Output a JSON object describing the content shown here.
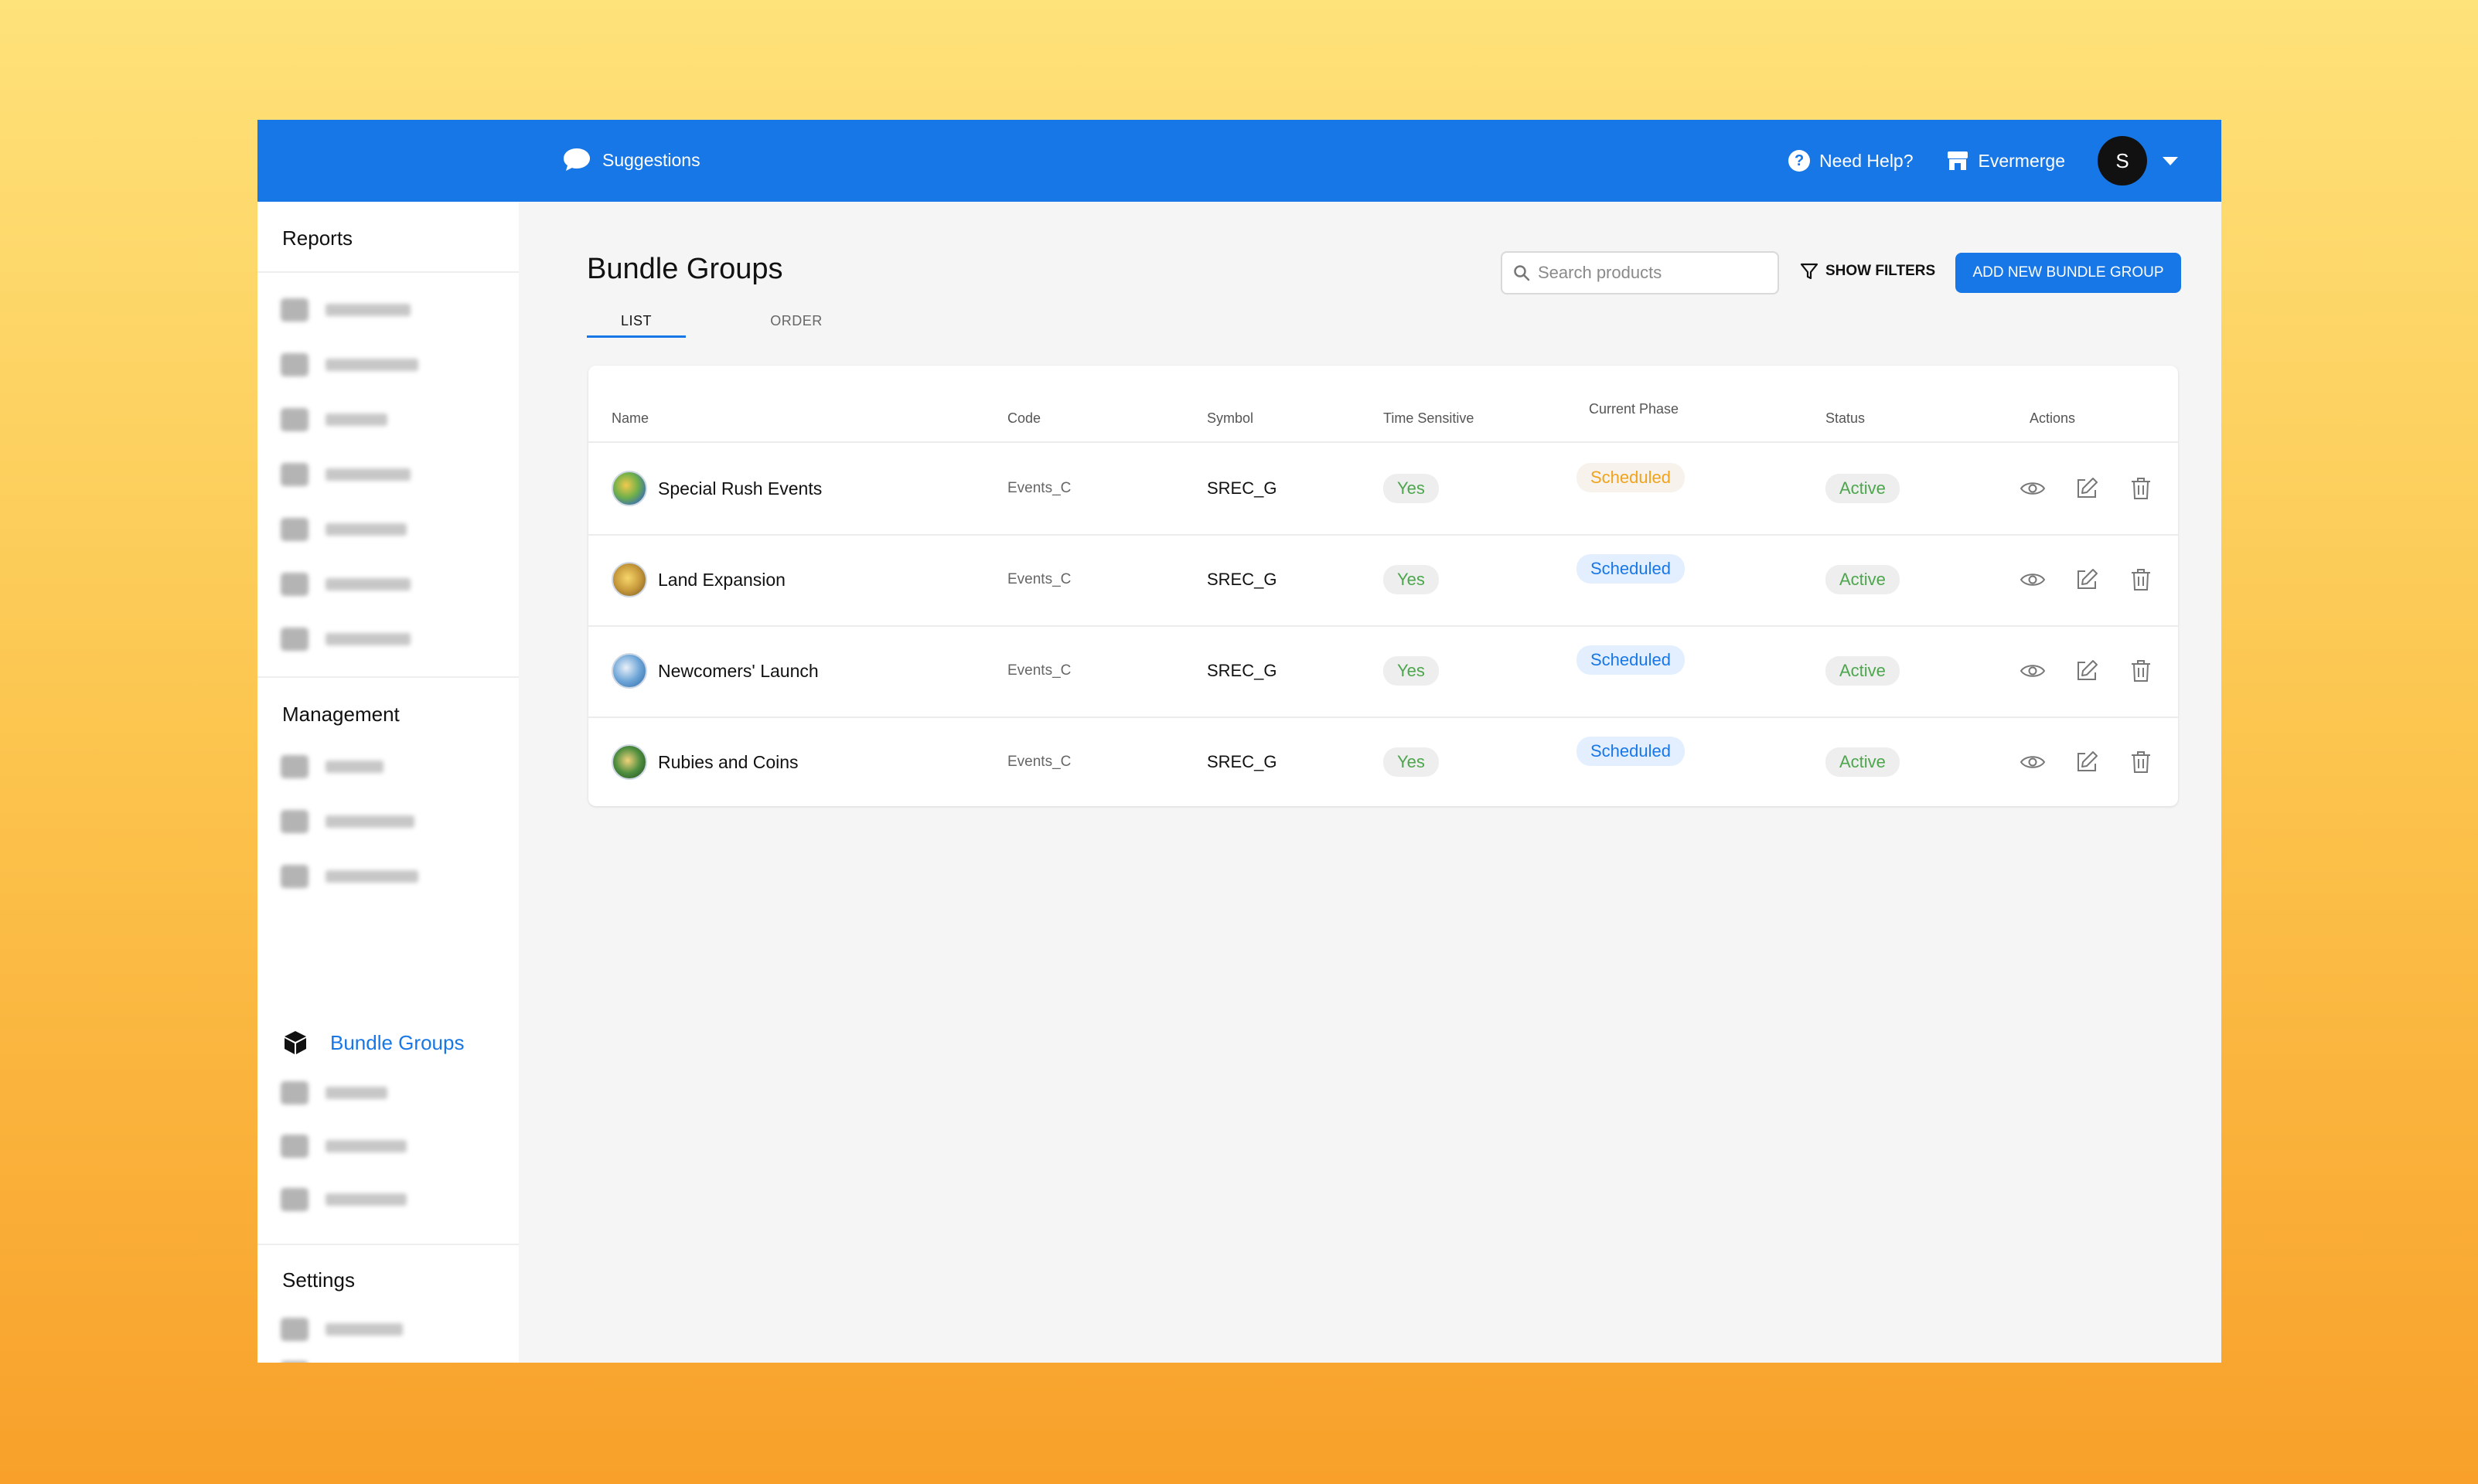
{
  "topbar": {
    "suggestions": "Suggestions",
    "help": "Need Help?",
    "store": "Evermerge",
    "avatar_letter": "S"
  },
  "sidebar": {
    "sections": [
      "Reports",
      "Management",
      "Settings"
    ],
    "active_item": "Bundle Groups"
  },
  "page": {
    "title": "Bundle Groups",
    "tabs": [
      "LIST",
      "ORDER"
    ],
    "search_placeholder": "Search products",
    "show_filters": "SHOW FILTERS",
    "add_button": "ADD NEW BUNDLE GROUP"
  },
  "table": {
    "headers": [
      "Name",
      "Code",
      "Symbol",
      "Time Sensitive",
      "Current Phase",
      "Status",
      "Actions"
    ],
    "rows": [
      {
        "name": "Special Rush Events",
        "code": "Events_C",
        "symbol": "SREC_G",
        "time_sensitive": "Yes",
        "phase": "Scheduled",
        "status": "Active"
      },
      {
        "name": "Land Expansion",
        "code": "Events_C",
        "symbol": "SREC_G",
        "time_sensitive": "Yes",
        "phase": "Scheduled",
        "status": "Active"
      },
      {
        "name": "Newcomers' Launch",
        "code": "Events_C",
        "symbol": "SREC_G",
        "time_sensitive": "Yes",
        "phase": "Scheduled",
        "status": "Active"
      },
      {
        "name": "Rubies and Coins",
        "code": "Events_C",
        "symbol": "SREC_G",
        "time_sensitive": "Yes",
        "phase": "Scheduled",
        "status": "Active"
      }
    ]
  },
  "colors": {
    "accent": "#1877e6",
    "active_green": "#4ca64c",
    "scheduled_orange": "#f0a31d"
  }
}
